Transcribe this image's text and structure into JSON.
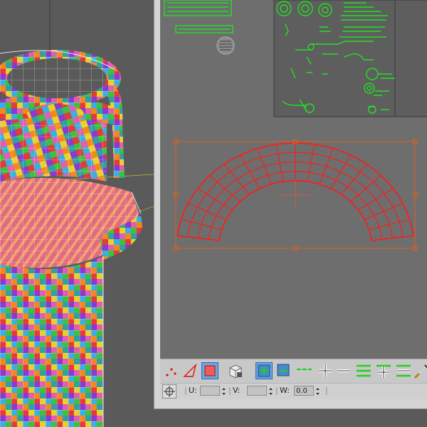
{
  "viewport3d": {
    "object": "milk can",
    "background_color": "#5a5a5a"
  },
  "uv_editor": {
    "background_color": "#d4d4d4",
    "canvas_color": "#6e6e6e",
    "texture_tile_color": "#5e5e5e",
    "uv_line_color": "#22e022",
    "selection_color": "#ff1a1a",
    "gizmo_color": "#e06020",
    "toolbar": {
      "buttons": [
        {
          "name": "vertex-mode-icon",
          "active": false
        },
        {
          "name": "edge-mode-icon",
          "active": false
        },
        {
          "name": "polygon-mode-icon",
          "active": true
        },
        {
          "name": "element-mode-icon",
          "active": false
        },
        {
          "name": "grow-selection-icon",
          "active": true
        },
        {
          "name": "shrink-selection-icon",
          "active": false
        },
        {
          "name": "ring-shrink-icon",
          "active": false
        },
        {
          "name": "ring-grow-icon",
          "active": false
        },
        {
          "name": "ring-minus-icon",
          "active": false
        },
        {
          "name": "loop-shrink-icon",
          "active": false
        },
        {
          "name": "loop-grow-icon",
          "active": false
        },
        {
          "name": "loop-minus-icon",
          "active": false
        },
        {
          "name": "paint-select-icon",
          "active": false
        }
      ]
    },
    "statusbar": {
      "u_label": "U:",
      "u_value": "",
      "v_label": "V:",
      "v_value": "",
      "w_label": "W:",
      "w_value": "0.0"
    }
  }
}
